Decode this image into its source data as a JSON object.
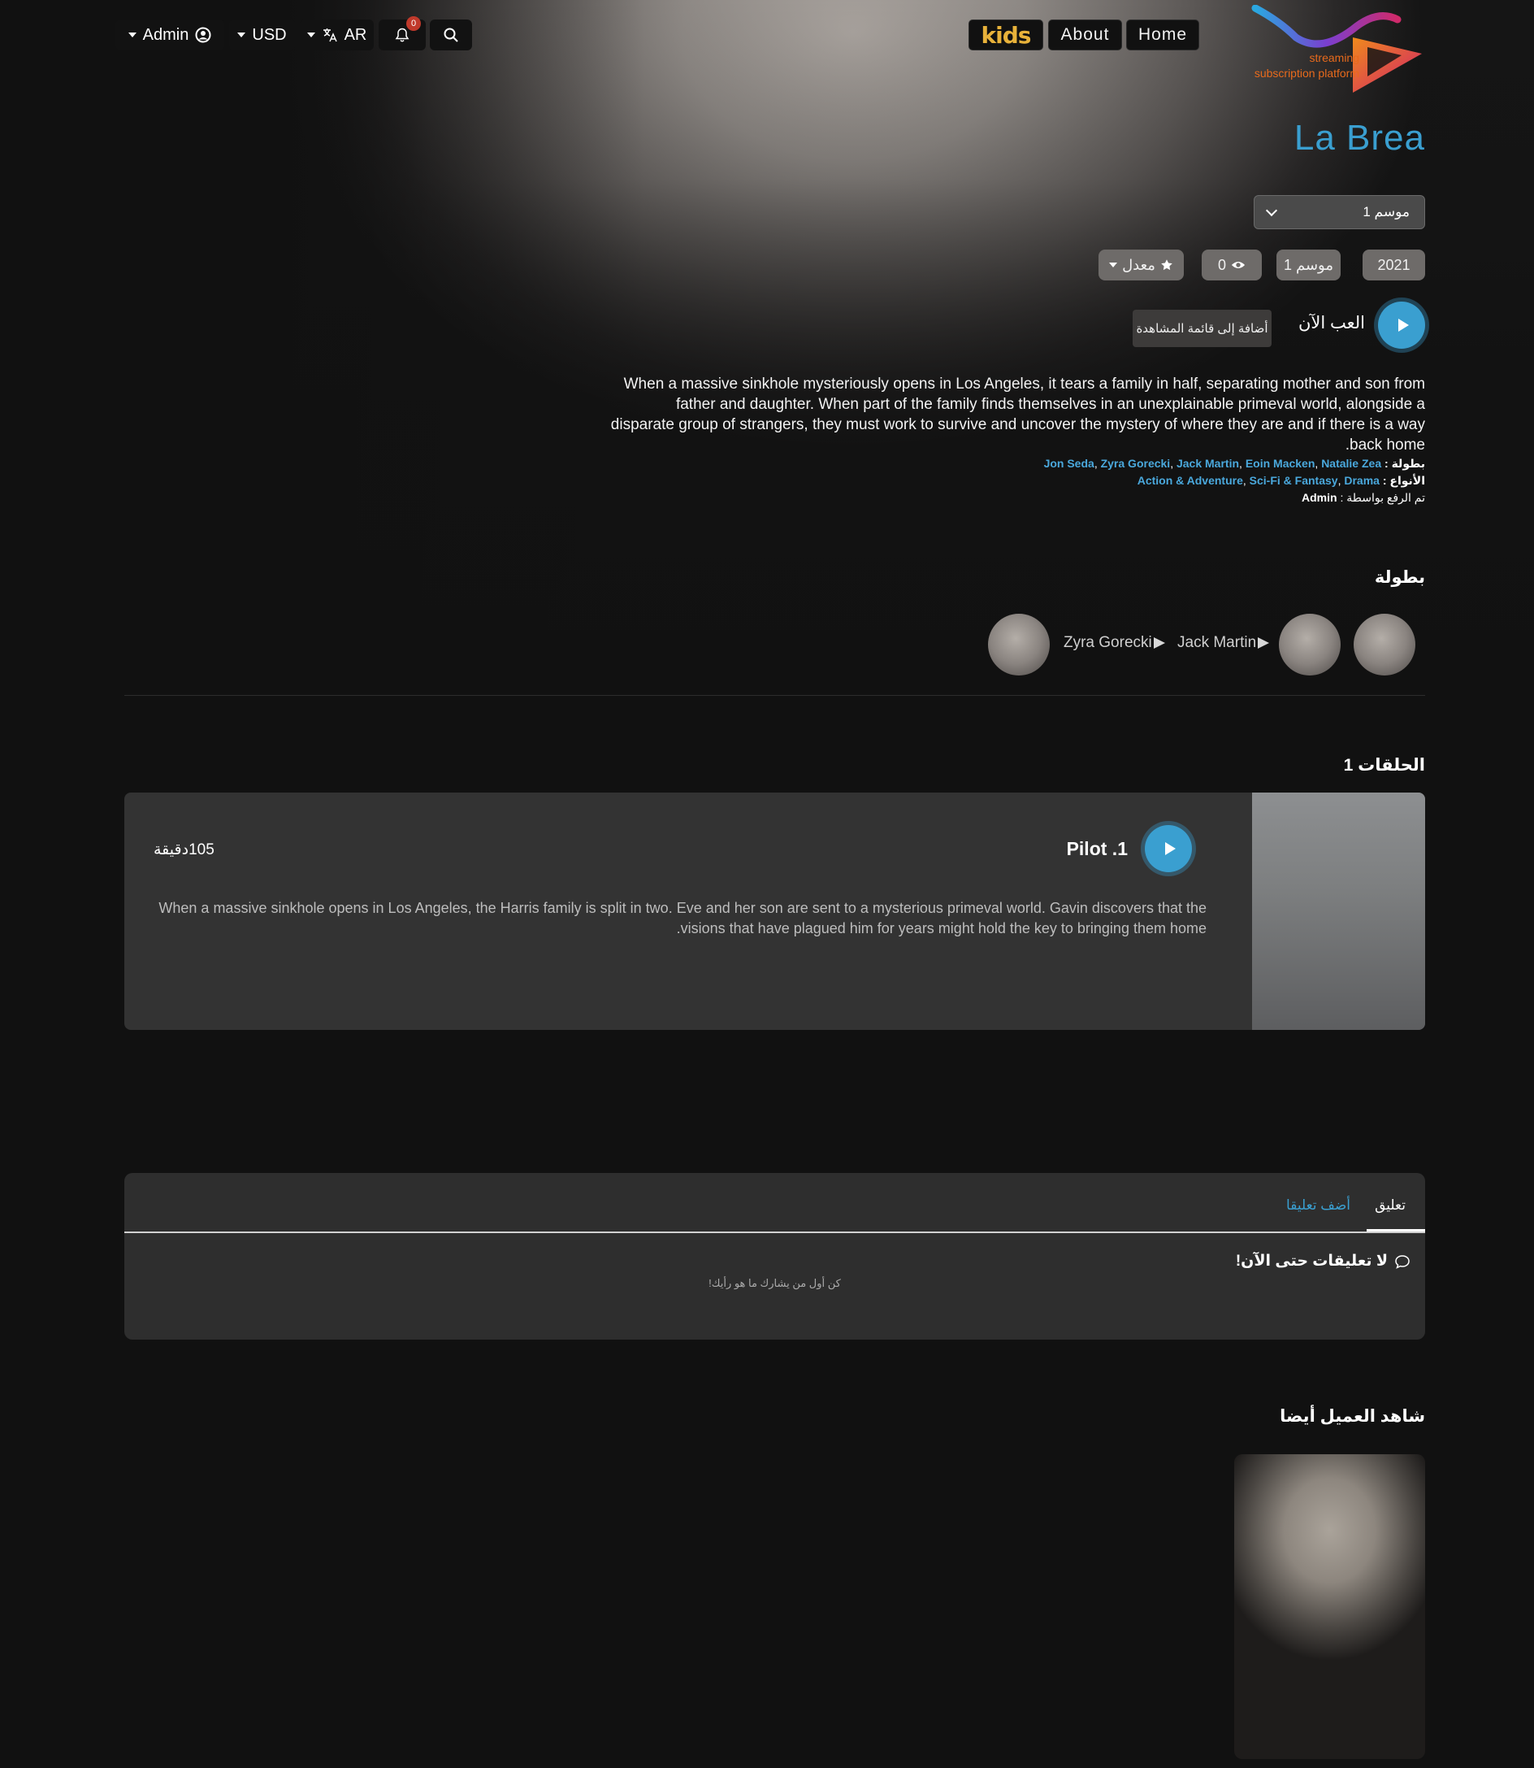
{
  "header": {
    "user_label": "Admin",
    "currency_label": "USD",
    "language_label": "AR",
    "notification_count": "0",
    "nav": {
      "kids": "kids",
      "about": "About",
      "home": "Home"
    },
    "logo": {
      "line1": "streaming",
      "line2": "subscription platform"
    }
  },
  "show": {
    "title": "La Brea",
    "season_select": "موسم 1",
    "year": "2021",
    "seasons_count": "1 موسم",
    "views": "0",
    "rating_label": "معدل",
    "play_now_label": "العب الآن",
    "watchlist_label": "أضافة إلى قائمة المشاهدة",
    "description": "When a massive sinkhole mysteriously opens in Los Angeles, it tears a family in half, separating mother and son from father and daughter. When part of the family finds themselves in an unexplainable primeval world, alongside a disparate group of strangers, they must work to survive and uncover the mystery of where they are and if there is a way back home.",
    "starring_label": "بطولة :",
    "starring": [
      "Jon Seda",
      "Zyra Gorecki",
      "Jack Martin",
      "Eoin Macken",
      "Natalie Zea"
    ],
    "genres_label": "الأنواع :",
    "genres": [
      "Action & Adventure",
      "Sci-Fi & Fantasy",
      "Drama"
    ],
    "uploaded_by_label": "تم الرفع بواسطة :",
    "uploaded_by": "Admin"
  },
  "cast": {
    "heading": "بطولة",
    "names": [
      "Jack Martin",
      "Zyra Gorecki"
    ]
  },
  "episodes": {
    "heading": "الحلقات 1",
    "items": [
      {
        "title": "1. Pilot",
        "duration": "105دقيقة",
        "description": "When a massive sinkhole opens in Los Angeles, the Harris family is split in two. Eve and her son are sent to a mysterious primeval world. Gavin discovers that the visions that have plagued him for years might hold the key to bringing them home."
      }
    ]
  },
  "comments": {
    "tab_comment": "تعليق",
    "tab_add": "أضف تعليقا",
    "empty_title": "لا تعليقات حتى الآن!",
    "empty_subtitle": "كن أول من يشارك ما هو رأيك!"
  },
  "also_watched": {
    "heading": "شاهد العميل أيضا"
  },
  "colors": {
    "accent": "#3a9fd0",
    "kids": "#e8b23a",
    "badge": "#c0392b",
    "background": "#111111"
  }
}
